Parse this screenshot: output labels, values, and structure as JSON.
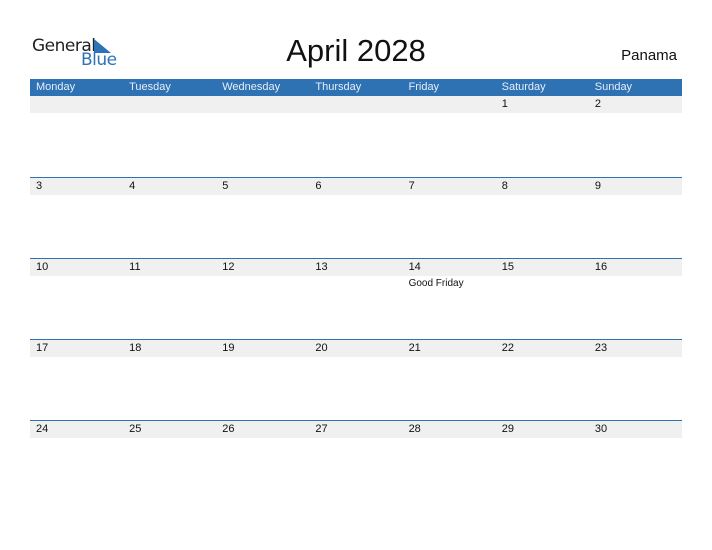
{
  "logo": {
    "text1": "General",
    "text2": "Blue",
    "accent": "#2e73b8"
  },
  "title": "April 2028",
  "country": "Panama",
  "header_color": "#2e72b4",
  "weekdays": [
    "Monday",
    "Tuesday",
    "Wednesday",
    "Thursday",
    "Friday",
    "Saturday",
    "Sunday"
  ],
  "weeks": [
    [
      {
        "d": ""
      },
      {
        "d": ""
      },
      {
        "d": ""
      },
      {
        "d": ""
      },
      {
        "d": ""
      },
      {
        "d": "1"
      },
      {
        "d": "2"
      }
    ],
    [
      {
        "d": "3"
      },
      {
        "d": "4"
      },
      {
        "d": "5"
      },
      {
        "d": "6"
      },
      {
        "d": "7"
      },
      {
        "d": "8"
      },
      {
        "d": "9"
      }
    ],
    [
      {
        "d": "10"
      },
      {
        "d": "11"
      },
      {
        "d": "12"
      },
      {
        "d": "13"
      },
      {
        "d": "14",
        "event": "Good Friday"
      },
      {
        "d": "15"
      },
      {
        "d": "16"
      }
    ],
    [
      {
        "d": "17"
      },
      {
        "d": "18"
      },
      {
        "d": "19"
      },
      {
        "d": "20"
      },
      {
        "d": "21"
      },
      {
        "d": "22"
      },
      {
        "d": "23"
      }
    ],
    [
      {
        "d": "24"
      },
      {
        "d": "25"
      },
      {
        "d": "26"
      },
      {
        "d": "27"
      },
      {
        "d": "28"
      },
      {
        "d": "29"
      },
      {
        "d": "30"
      }
    ]
  ]
}
